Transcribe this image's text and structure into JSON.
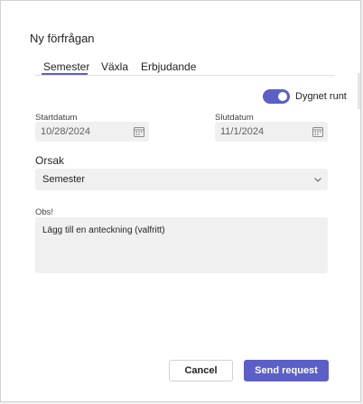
{
  "dialog": {
    "title": "Ny förfrågan"
  },
  "tabs": [
    {
      "label": "Semester",
      "active": true
    },
    {
      "label": "Växla",
      "active": false
    },
    {
      "label": "Erbjudande",
      "active": false
    }
  ],
  "all_day_toggle": {
    "label": "Dygnet runt",
    "on": true
  },
  "start_date": {
    "label": "Startdatum",
    "value": "10/28/2024",
    "icon": "calendar-icon"
  },
  "end_date": {
    "label": "Slutdatum",
    "value": "11/1/2024",
    "icon": "calendar-icon"
  },
  "reason": {
    "label": "Orsak",
    "selected": "Semester",
    "icon": "chevron-down-icon"
  },
  "note": {
    "label": "Obs!",
    "placeholder": "Lägg till en anteckning (valfritt)"
  },
  "buttons": {
    "cancel": "Cancel",
    "send": "Send request"
  },
  "colors": {
    "accent": "#5b5fc7",
    "field_background": "#f0f0f0"
  }
}
